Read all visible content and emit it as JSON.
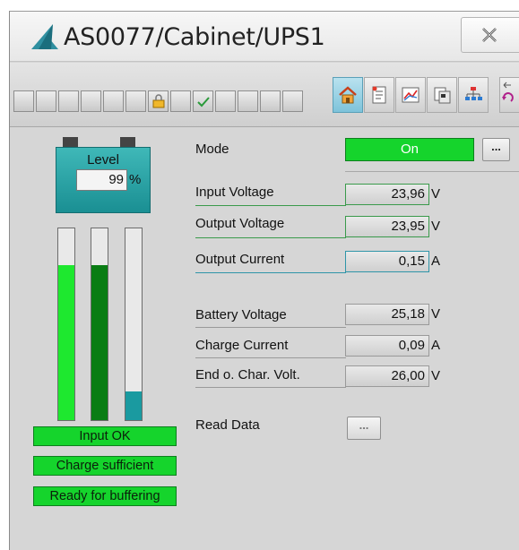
{
  "window": {
    "title": "AS0077/Cabinet/UPS1"
  },
  "level": {
    "label": "Level",
    "value": "99",
    "unit": "%",
    "fill_fraction": 0.99
  },
  "bars": [
    {
      "name": "input",
      "fill_fraction": 0.81,
      "color": "#1ee82f"
    },
    {
      "name": "charge",
      "fill_fraction": 0.81,
      "color": "#0a7d14"
    },
    {
      "name": "buffer",
      "fill_fraction": 0.15,
      "color": "#1a9aa0"
    }
  ],
  "status": {
    "input_ok": "Input OK",
    "charge_sufficient": "Charge sufficient",
    "ready_buffering": "Ready for buffering"
  },
  "mode": {
    "label": "Mode",
    "value": "On",
    "button": "..."
  },
  "fields": {
    "input_voltage": {
      "label": "Input Voltage",
      "value": "23,96",
      "unit": "V"
    },
    "output_voltage": {
      "label": "Output Voltage",
      "value": "23,95",
      "unit": "V"
    },
    "output_current": {
      "label": "Output Current",
      "value": "0,15",
      "unit": "A"
    },
    "battery_voltage": {
      "label": "Battery Voltage",
      "value": "25,18",
      "unit": "V"
    },
    "charge_current": {
      "label": "Charge Current",
      "value": "0,09",
      "unit": "A"
    },
    "end_charge_voltage": {
      "label": "End o. Char. Volt.",
      "value": "26,00",
      "unit": "V"
    }
  },
  "read_data": {
    "label": "Read Data",
    "button": "..."
  },
  "colors": {
    "status_green": "#15d42c",
    "level_teal": "#2aa6a8",
    "panel_bg": "#d6d6d6"
  },
  "toolbar_icons": [
    "home-icon",
    "notes-icon",
    "trend-chart-icon",
    "pages-icon",
    "hierarchy-icon"
  ]
}
